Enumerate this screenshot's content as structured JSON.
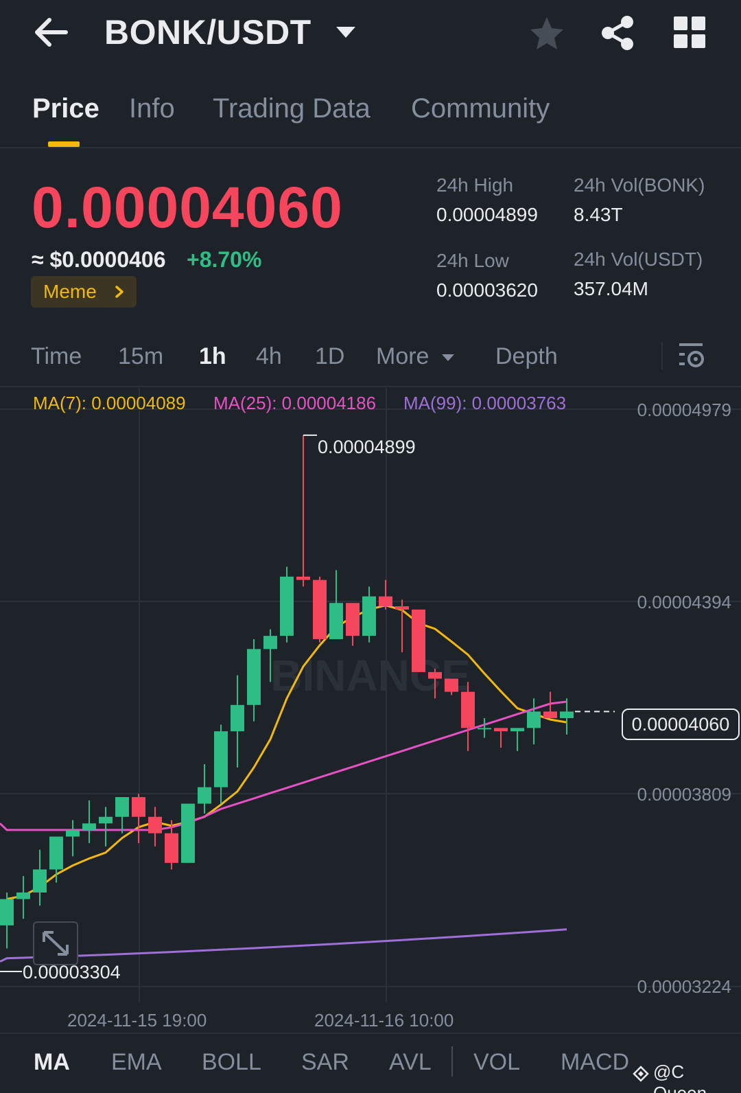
{
  "header": {
    "pair": "BONK/USDT",
    "icons": [
      "back-arrow-icon",
      "caret-down-icon",
      "star-icon",
      "share-icon",
      "grid-icon"
    ]
  },
  "tabs": [
    {
      "label": "Price",
      "active": true
    },
    {
      "label": "Info"
    },
    {
      "label": "Trading Data"
    },
    {
      "label": "Community"
    }
  ],
  "price": {
    "last": "0.00004060",
    "approx_usd": "≈ $0.0000406",
    "change": "+8.70%",
    "tag": "Meme",
    "colors": {
      "down": "#f6465d",
      "up": "#2ebd85",
      "accent": "#f0b90b"
    }
  },
  "stats": {
    "high_label": "24h High",
    "high_value": "0.00004899",
    "low_label": "24h Low",
    "low_value": "0.00003620",
    "vol_base_label": "24h Vol(BONK)",
    "vol_base_value": "8.43T",
    "vol_quote_label": "24h Vol(USDT)",
    "vol_quote_value": "357.04M"
  },
  "intervals": {
    "time": "Time",
    "m15": "15m",
    "h1": "1h",
    "h4": "4h",
    "d1": "1D",
    "more": "More",
    "depth": "Depth",
    "active": "1h"
  },
  "chart": {
    "ma7": "MA(7): 0.00004089",
    "ma25": "MA(25): 0.00004186",
    "ma99": "MA(99): 0.00003763",
    "y_labels": [
      "0.00004979",
      "0.00004394",
      "0.00003809",
      "0.00003224"
    ],
    "high_marker": "0.00004899",
    "low_marker": "0.00003304",
    "current_price": "0.00004060",
    "x_labels": [
      "2024-11-15 19:00",
      "2024-11-16 10:00"
    ],
    "watermark": "BINANCE"
  },
  "chart_data": {
    "type": "candlestick",
    "interval": "1h",
    "ylim": [
      3.224e-05,
      4.979e-05
    ],
    "candles": [
      {
        "o": 3.41e-05,
        "h": 3.51e-05,
        "l": 3.34e-05,
        "c": 3.49e-05
      },
      {
        "o": 3.49e-05,
        "h": 3.56e-05,
        "l": 3.43e-05,
        "c": 3.51e-05
      },
      {
        "o": 3.51e-05,
        "h": 3.64e-05,
        "l": 3.47e-05,
        "c": 3.58e-05
      },
      {
        "o": 3.58e-05,
        "h": 3.68e-05,
        "l": 3.54e-05,
        "c": 3.68e-05
      },
      {
        "o": 3.68e-05,
        "h": 3.73e-05,
        "l": 3.62e-05,
        "c": 3.7e-05
      },
      {
        "o": 3.7e-05,
        "h": 3.79e-05,
        "l": 3.66e-05,
        "c": 3.72e-05
      },
      {
        "o": 3.72e-05,
        "h": 3.77e-05,
        "l": 3.65e-05,
        "c": 3.74e-05
      },
      {
        "o": 3.74e-05,
        "h": 3.8e-05,
        "l": 3.69e-05,
        "c": 3.8e-05
      },
      {
        "o": 3.8e-05,
        "h": 3.81e-05,
        "l": 3.66e-05,
        "c": 3.74e-05
      },
      {
        "o": 3.74e-05,
        "h": 3.77e-05,
        "l": 3.65e-05,
        "c": 3.69e-05
      },
      {
        "o": 3.69e-05,
        "h": 3.73e-05,
        "l": 3.58e-05,
        "c": 3.6e-05
      },
      {
        "o": 3.6e-05,
        "h": 3.78e-05,
        "l": 3.6e-05,
        "c": 3.78e-05
      },
      {
        "o": 3.78e-05,
        "h": 3.9e-05,
        "l": 3.75e-05,
        "c": 3.83e-05
      },
      {
        "o": 3.83e-05,
        "h": 4.02e-05,
        "l": 3.78e-05,
        "c": 4e-05
      },
      {
        "o": 4e-05,
        "h": 4.17e-05,
        "l": 3.89e-05,
        "c": 4.08e-05
      },
      {
        "o": 4.08e-05,
        "h": 4.28e-05,
        "l": 4.03e-05,
        "c": 4.25e-05
      },
      {
        "o": 4.25e-05,
        "h": 4.31e-05,
        "l": 4.15e-05,
        "c": 4.29e-05
      },
      {
        "o": 4.29e-05,
        "h": 4.5e-05,
        "l": 4.27e-05,
        "c": 4.47e-05
      },
      {
        "o": 4.47e-05,
        "h": 4.9e-05,
        "l": 4.44e-05,
        "c": 4.46e-05
      },
      {
        "o": 4.46e-05,
        "h": 4.47e-05,
        "l": 4.27e-05,
        "c": 4.28e-05
      },
      {
        "o": 4.28e-05,
        "h": 4.49e-05,
        "l": 4.28e-05,
        "c": 4.39e-05
      },
      {
        "o": 4.39e-05,
        "h": 4.39e-05,
        "l": 4.26e-05,
        "c": 4.29e-05
      },
      {
        "o": 4.29e-05,
        "h": 4.44e-05,
        "l": 4.27e-05,
        "c": 4.41e-05
      },
      {
        "o": 4.41e-05,
        "h": 4.46e-05,
        "l": 4.37e-05,
        "c": 4.38e-05
      },
      {
        "o": 4.38e-05,
        "h": 4.4e-05,
        "l": 4.24e-05,
        "c": 4.37e-05
      },
      {
        "o": 4.37e-05,
        "h": 4.37e-05,
        "l": 4.18e-05,
        "c": 4.18e-05
      },
      {
        "o": 4.18e-05,
        "h": 4.19e-05,
        "l": 4.1e-05,
        "c": 4.16e-05
      },
      {
        "o": 4.16e-05,
        "h": 4.16e-05,
        "l": 4.11e-05,
        "c": 4.12e-05
      },
      {
        "o": 4.12e-05,
        "h": 4.15e-05,
        "l": 3.94e-05,
        "c": 4.01e-05
      },
      {
        "o": 4.01e-05,
        "h": 4.04e-05,
        "l": 3.98e-05,
        "c": 4.01e-05
      },
      {
        "o": 4.01e-05,
        "h": 4.01e-05,
        "l": 3.95e-05,
        "c": 4e-05
      },
      {
        "o": 4e-05,
        "h": 4.01e-05,
        "l": 3.94e-05,
        "c": 4.01e-05
      },
      {
        "o": 4.01e-05,
        "h": 4.1e-05,
        "l": 3.96e-05,
        "c": 4.06e-05
      },
      {
        "o": 4.06e-05,
        "h": 4.12e-05,
        "l": 4.04e-05,
        "c": 4.04e-05
      },
      {
        "o": 4.04e-05,
        "h": 4.1e-05,
        "l": 3.99e-05,
        "c": 4.06e-05
      }
    ]
  },
  "indicators": {
    "ma": "MA",
    "ema": "EMA",
    "boll": "BOLL",
    "sar": "SAR",
    "avl": "AVL",
    "vol": "VOL",
    "macd": "MACD",
    "active": "MA"
  },
  "watermark_user": "@C Queen"
}
